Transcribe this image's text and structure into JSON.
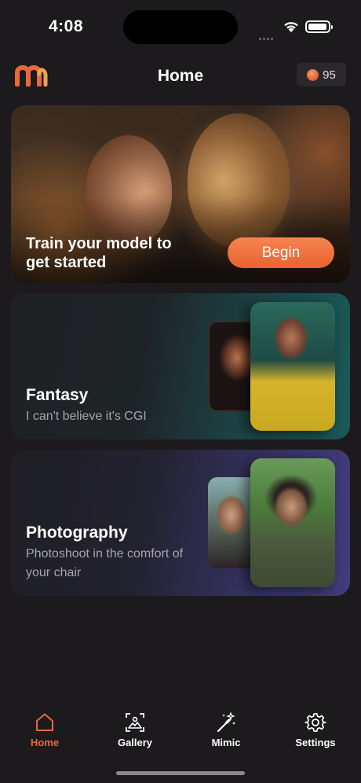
{
  "status_bar": {
    "time": "4:08"
  },
  "header": {
    "title": "Home",
    "credits": "95"
  },
  "hero": {
    "text": "Train your model to get started",
    "button_label": "Begin"
  },
  "categories": [
    {
      "title": "Fantasy",
      "subtitle": "I can't believe it's CGI"
    },
    {
      "title": "Photography",
      "subtitle": "Photoshoot in the comfort of your chair"
    }
  ],
  "tabs": [
    {
      "label": "Home",
      "icon": "home-icon",
      "active": true
    },
    {
      "label": "Gallery",
      "icon": "gallery-icon",
      "active": false
    },
    {
      "label": "Mimic",
      "icon": "magic-wand-icon",
      "active": false
    },
    {
      "label": "Settings",
      "icon": "gear-icon",
      "active": false
    }
  ],
  "colors": {
    "accent": "#e8693a",
    "background": "#1c1a1d"
  }
}
